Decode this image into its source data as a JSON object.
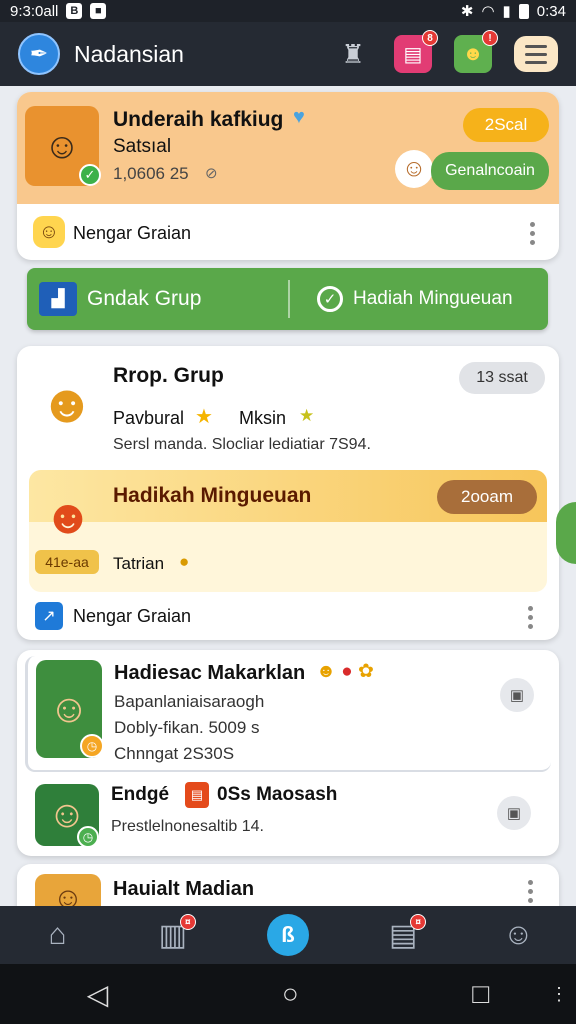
{
  "status_bar": {
    "carrier": "9:3:0all",
    "icon_a": "B",
    "icon_b": "⬛",
    "time": "0:34"
  },
  "app_bar": {
    "title": "Nadansian",
    "badge_1": "8",
    "badge_2": "!"
  },
  "hero": {
    "title": "Underaih kafkiug",
    "subtitle": "Satsıal",
    "stats": "1,0606 25",
    "stats_icon": "⊘",
    "pill": "2Scal",
    "action_label": "Genalncoain"
  },
  "hero_footer": {
    "label": "Nengar Graian"
  },
  "green_bar": {
    "left_label": "Gndak Grup",
    "right_label": "Hadiah Mingueuan"
  },
  "group_card": {
    "title": "Rrop. Grup",
    "pill": "13 ssat",
    "line1_a": "Pavbural",
    "line1_b": "Mksin",
    "line2": "Sersl manda. Slocliar lediatiar 7S94.",
    "inner": {
      "title": "Hadikah Mingueuan",
      "pill": "2ooam",
      "sub_label": "Tatrian",
      "badge": "41e-aa"
    },
    "footer_label": "Nengar Graian"
  },
  "list_card": {
    "items": [
      {
        "title": "Hadiesac Makarklan",
        "line1": "Bapanlaniaisaraogh",
        "line2": "Dobly-fikan. 5009 s",
        "line3": "Chnngat 2S30S"
      },
      {
        "title": "Endgé",
        "title_b": "0Ss Maosash",
        "line1": "Prestlelnonesaltib 14."
      }
    ]
  },
  "partial_card": {
    "title": "Hauialt Madian"
  },
  "bottom_nav": {
    "badge_1": "¤",
    "center": "ß",
    "badge_2": "¤"
  },
  "colors": {
    "accent_orange": "#f9c88d",
    "accent_green": "#5aa84a",
    "appbar": "#252a33"
  }
}
